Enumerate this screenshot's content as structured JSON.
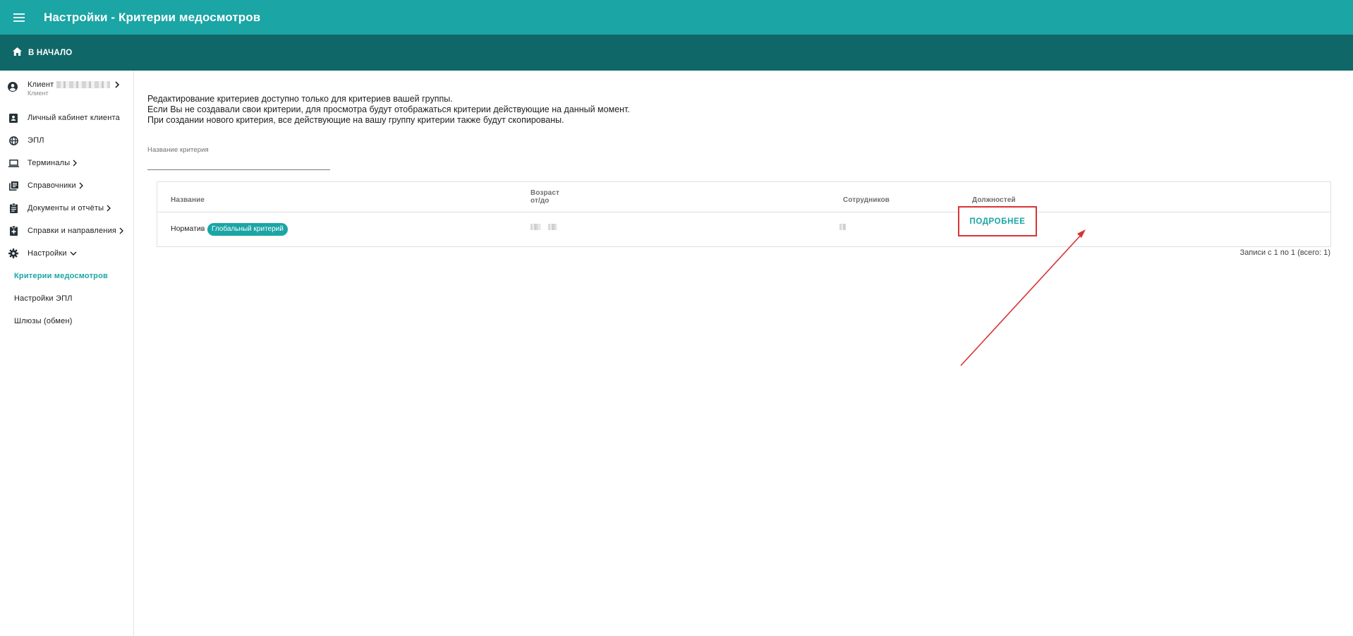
{
  "header": {
    "title": "Настройки - Критерии медосмотров",
    "menu_icon": "hamburger-menu-icon"
  },
  "subheader": {
    "home_label": "В НАЧАЛО",
    "home_icon": "home-icon"
  },
  "sidebar": {
    "client": {
      "label": "Клиент",
      "sublabel": "Клиент",
      "icon": "account-circle-icon"
    },
    "items": [
      {
        "label": "Личный кабинет клиента",
        "icon": "contact-card-icon",
        "has_chevron": false
      },
      {
        "label": "ЭПЛ",
        "icon": "globe-icon",
        "has_chevron": false
      },
      {
        "label": "Терминалы",
        "icon": "laptop-icon",
        "has_chevron": true
      },
      {
        "label": "Справочники",
        "icon": "library-books-icon",
        "has_chevron": true
      },
      {
        "label": "Документы и отчёты",
        "icon": "clipboard-icon",
        "has_chevron": true
      },
      {
        "label": "Справки и направления",
        "icon": "clipboard-plus-icon",
        "has_chevron": true
      },
      {
        "label": "Настройки",
        "icon": "gear-icon",
        "has_chevron": true,
        "expanded": true
      }
    ],
    "subitems": [
      {
        "label": "Критерии медосмотров",
        "active": true
      },
      {
        "label": "Настройки ЭПЛ",
        "active": false
      },
      {
        "label": "Шлюзы (обмен)",
        "active": false
      }
    ]
  },
  "main": {
    "info_lines": [
      "Редактирование критериев доступно только для критериев вашей группы.",
      "Если Вы не создавали свои критерии, для просмотра будут отображаться критерии действующие на данный момент.",
      "При создании нового критерия, все действующие на вашу группу критерии также будут скопированы."
    ],
    "filter": {
      "label": "Название критерия",
      "value": ""
    },
    "table": {
      "columns": {
        "name": "Название",
        "age_line1": "Возраст",
        "age_line2": "от/до",
        "employees": "Сотрудников",
        "positions": "Должностей"
      },
      "rows": [
        {
          "name": "Норматив",
          "badge": "Глобальный критерий",
          "action": "ПОДРОБНЕЕ"
        }
      ]
    },
    "records": "Записи с 1 по 1 (всего: 1)"
  },
  "colors": {
    "primary": "#1ba5a5",
    "primary_dark": "#106767",
    "highlight": "#d73434"
  }
}
